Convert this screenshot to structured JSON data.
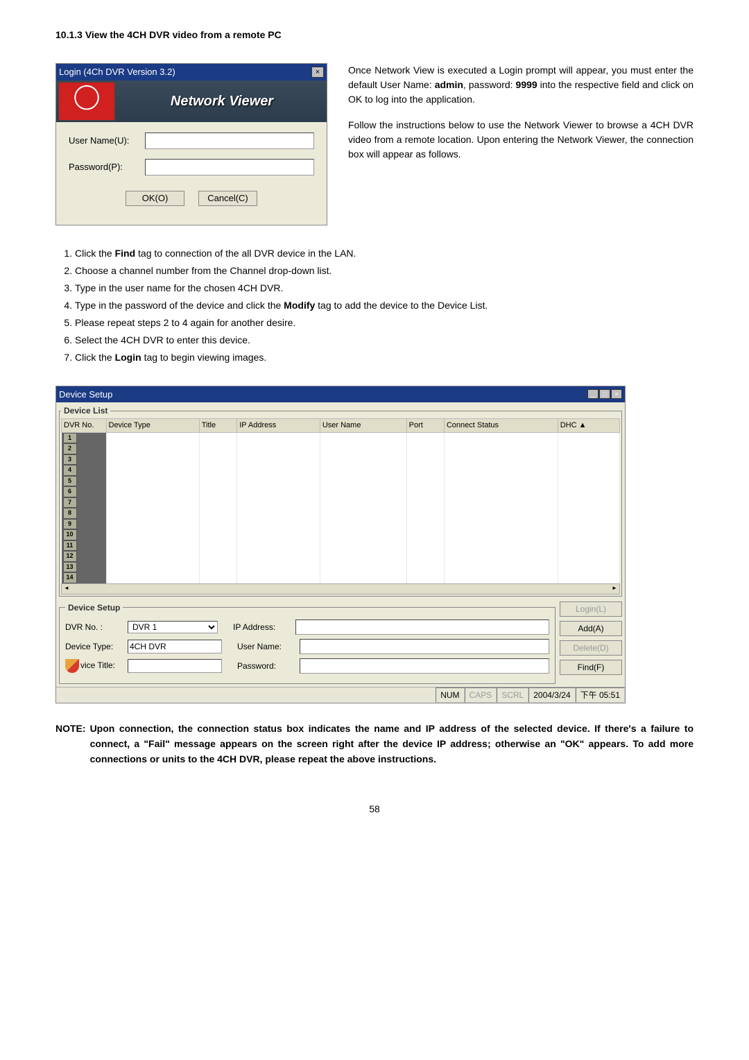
{
  "heading": "10.1.3   View the 4CH DVR video from a remote PC",
  "login_dialog": {
    "title": "Login (4Ch DVR Version 3.2)",
    "header_brand": "Network Viewer",
    "username_label": "User Name(U):",
    "password_label": "Password(P):",
    "ok_label": "OK(O)",
    "cancel_label": "Cancel(C)"
  },
  "para1_a": "Once Network View is executed a Login prompt will appear, you must enter the default User Name: ",
  "para1_admin": "admin",
  "para1_b": ", password: ",
  "para1_pw": "9999",
  "para1_c": " into the respective field and click on OK to log into the application.",
  "para2": "Follow the instructions below to use the Network Viewer to browse a 4CH DVR video from a remote location. Upon entering the Network Viewer, the connection box will appear as follows.",
  "steps": [
    {
      "pre": "Click the ",
      "bold": "Find",
      "post": " tag to connection of the all DVR device in the LAN."
    },
    {
      "pre": "Choose a channel number from the Channel drop-down list.",
      "bold": "",
      "post": ""
    },
    {
      "pre": "Type in the user name for the chosen 4CH DVR.",
      "bold": "",
      "post": ""
    },
    {
      "pre": "Type in the password of the device and click the ",
      "bold": "Modify",
      "post": " tag to add the device to the Device List."
    },
    {
      "pre": "Please repeat steps 2 to 4 again for another desire.",
      "bold": "",
      "post": ""
    },
    {
      "pre": "Select the 4CH DVR to enter this device.",
      "bold": "",
      "post": ""
    },
    {
      "pre": "Click the ",
      "bold": "Login",
      "post": " tag to begin viewing images."
    }
  ],
  "device_setup": {
    "title": "Device Setup",
    "legend_list": "Device List",
    "columns": [
      "DVR No.",
      "Device Type",
      "Title",
      "IP Address",
      "User Name",
      "Port",
      "Connect Status",
      "DHC"
    ],
    "rows": [
      "1",
      "2",
      "3",
      "4",
      "5",
      "6",
      "7",
      "8",
      "9",
      "10",
      "11",
      "12",
      "13",
      "14"
    ],
    "legend_setup": "Device Setup",
    "dvr_no_label": "DVR No. :",
    "dvr_no_value": "DVR 1",
    "device_type_label": "Device Type:",
    "device_type_value": "4CH DVR",
    "vice_title_label": "vice Title:",
    "ip_label": "IP Address:",
    "username_label": "User Name:",
    "password_label": "Password:",
    "btn_login": "Login(L)",
    "btn_add": "Add(A)",
    "btn_delete": "Delete(D)",
    "btn_find": "Find(F)",
    "status": {
      "num": "NUM",
      "caps": "CAPS",
      "scrl": "SCRL",
      "date": "2004/3/24",
      "time": "下午 05:51"
    }
  },
  "note_label": "NOTE:",
  "note_text": "Upon connection, the connection status box indicates the name and IP address of the selected device. If there's a failure to connect, a \"Fail\" message appears on the screen right after the device IP address; otherwise an \"OK\" appears. To add more connections or units to the 4CH DVR, please repeat the above instructions.",
  "page_number": "58"
}
